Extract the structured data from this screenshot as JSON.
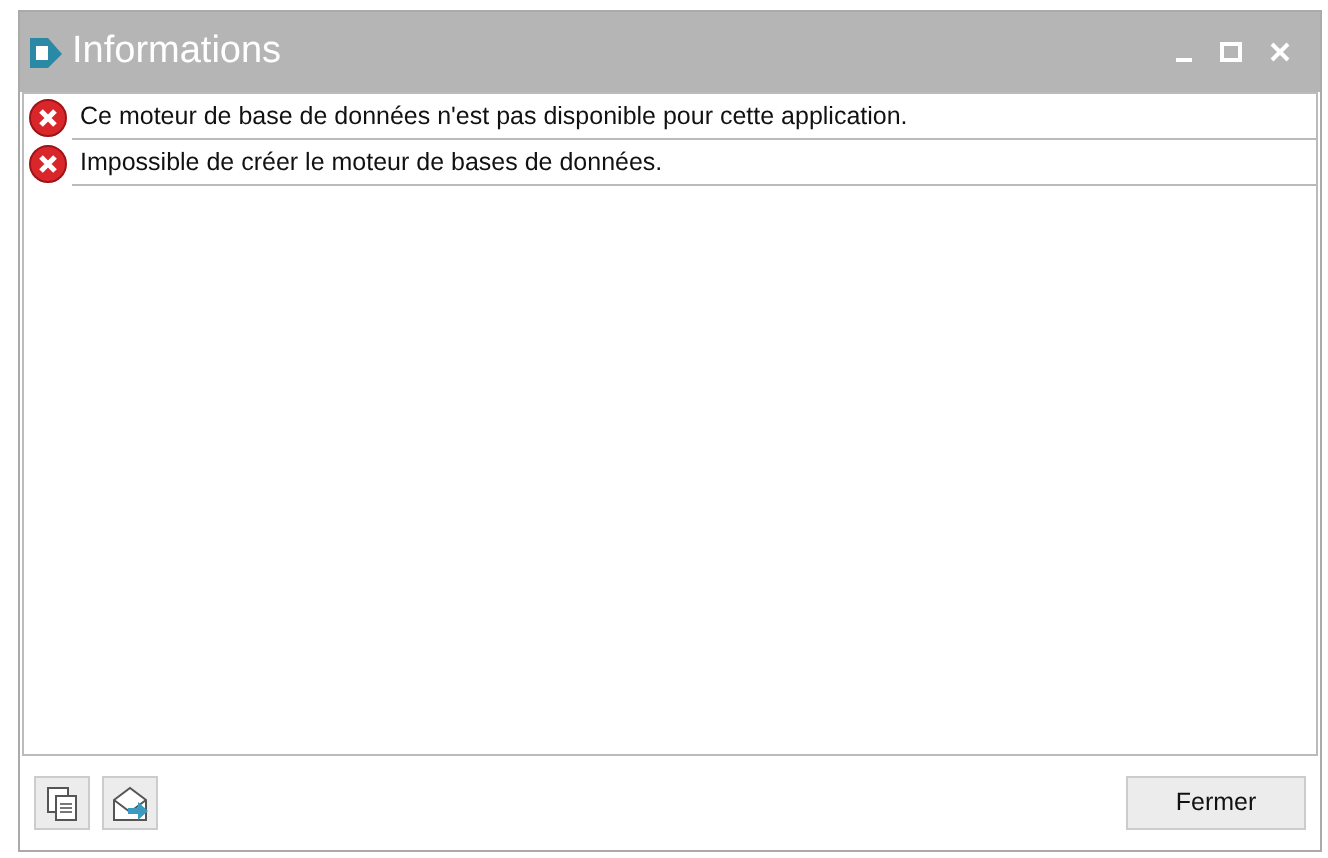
{
  "window": {
    "title": "Informations"
  },
  "messages": [
    {
      "kind": "error",
      "text": "Ce moteur de base de données n'est pas disponible pour cette application."
    },
    {
      "kind": "error",
      "text": "Impossible de créer le moteur de bases de données."
    }
  ],
  "buttons": {
    "close": "Fermer"
  }
}
